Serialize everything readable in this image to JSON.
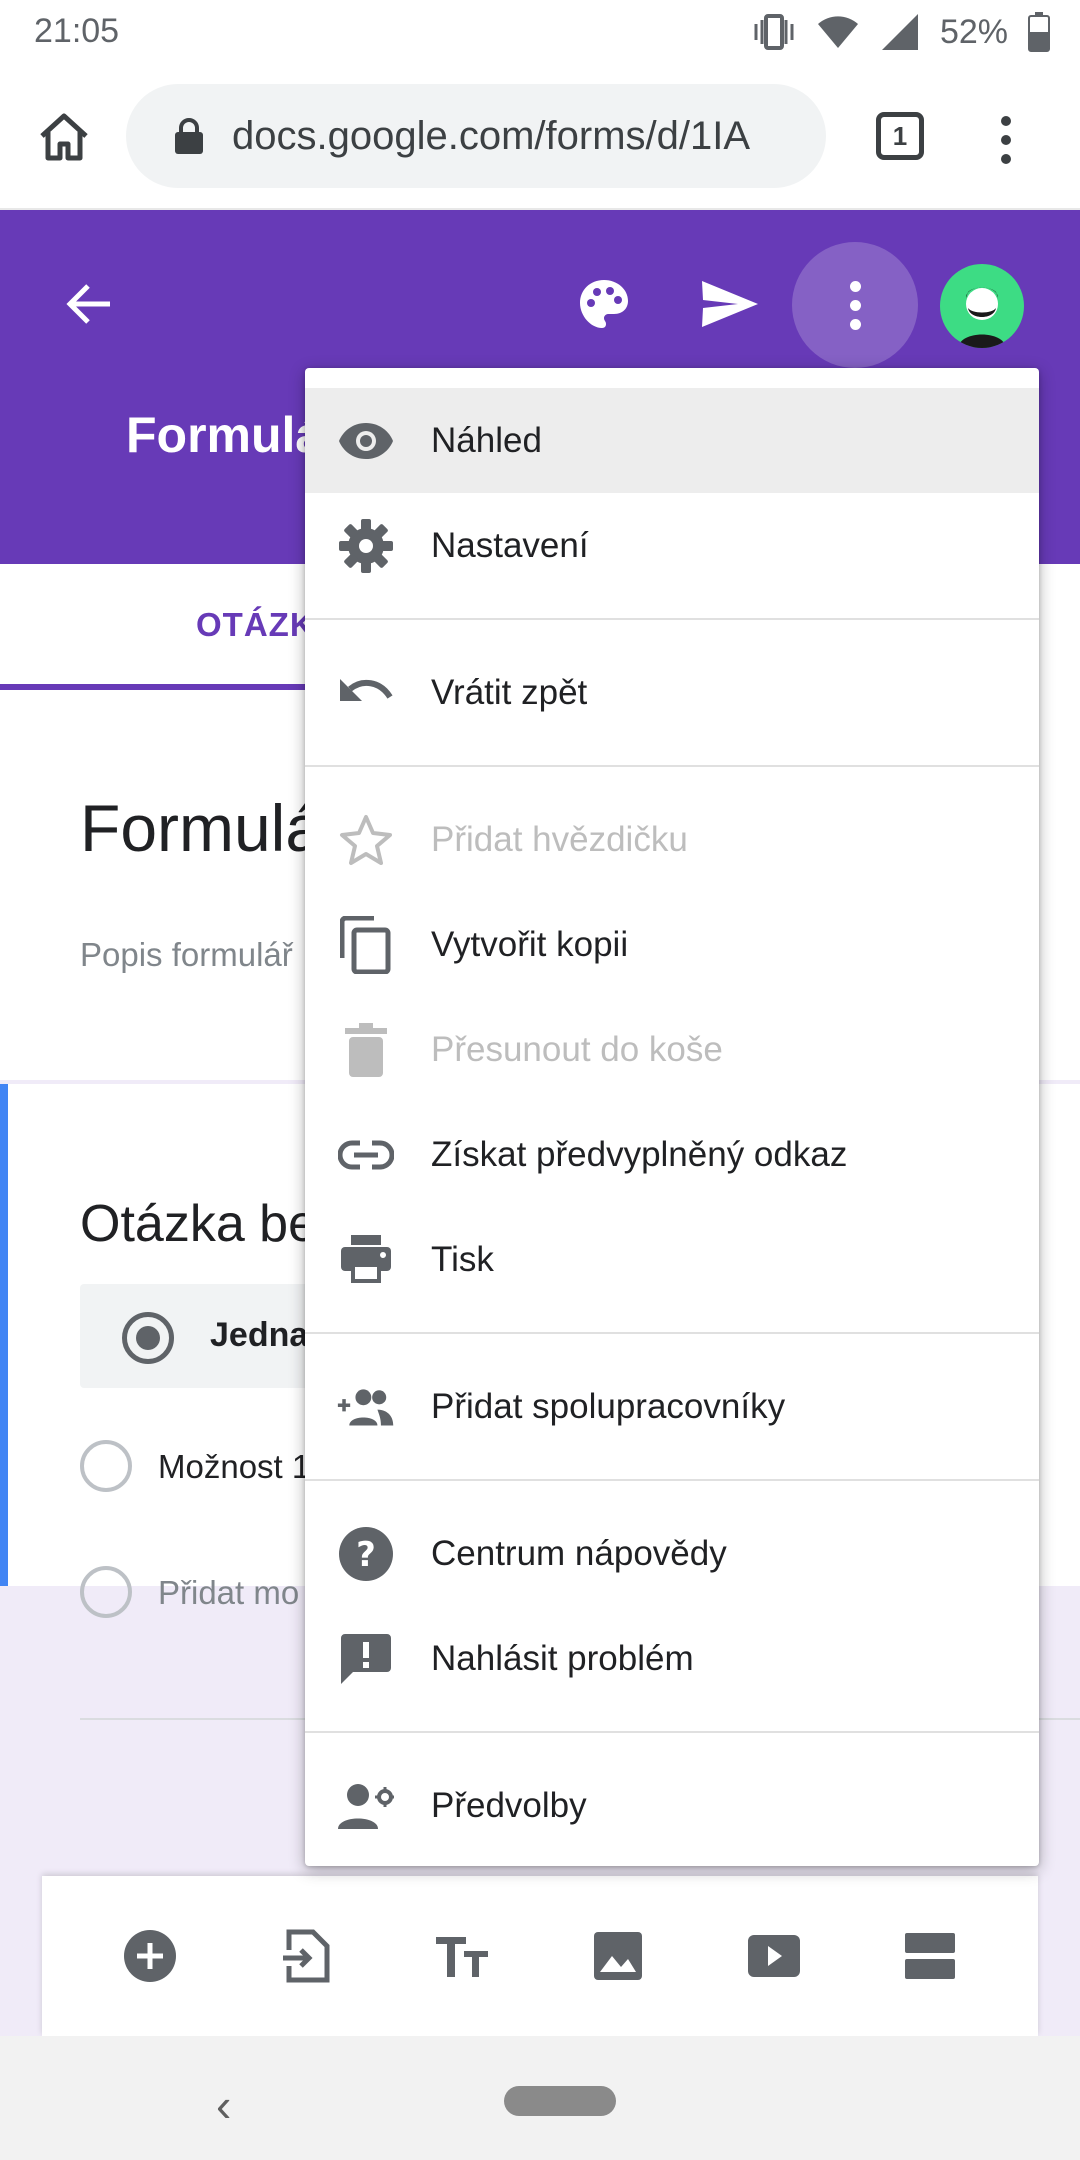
{
  "status_bar": {
    "time": "21:05",
    "battery": "52%"
  },
  "browser": {
    "url": "docs.google.com/forms/d/1IA",
    "tab_count": "1"
  },
  "header": {
    "form_title": "Formulá"
  },
  "tabs": {
    "questions": "OTÁZK"
  },
  "form": {
    "title": "Formulá",
    "description": "Popis formulář",
    "question_title": "Otázka be",
    "question_type": "Jedna",
    "option_1": "Možnost 1",
    "add_option": "Přidat mo"
  },
  "menu": {
    "preview": "Náhled",
    "settings": "Nastavení",
    "undo": "Vrátit zpět",
    "add_star": "Přidat hvězdičku",
    "make_copy": "Vytvořit kopii",
    "move_to_trash": "Přesunout do koše",
    "prefilled_link": "Získat předvyplněný odkaz",
    "print": "Tisk",
    "add_collaborators": "Přidat spolupracovníky",
    "help_center": "Centrum nápovědy",
    "report_problem": "Nahlásit problém",
    "preferences": "Předvolby"
  },
  "colors": {
    "accent": "#673ab7",
    "question_border": "#4285f4",
    "icon_gray": "#5f6368",
    "disabled": "#bdbdbd"
  },
  "icons": [
    "home-icon",
    "lock-icon",
    "back-arrow-icon",
    "palette-icon",
    "send-icon",
    "more-vert-icon",
    "eye-icon",
    "gear-icon",
    "undo-icon",
    "star-icon",
    "copy-icon",
    "trash-icon",
    "link-icon",
    "print-icon",
    "group-add-icon",
    "help-icon",
    "feedback-icon",
    "person-settings-icon",
    "add-circle-icon",
    "import-icon",
    "title-icon",
    "image-icon",
    "video-icon",
    "section-icon"
  ]
}
